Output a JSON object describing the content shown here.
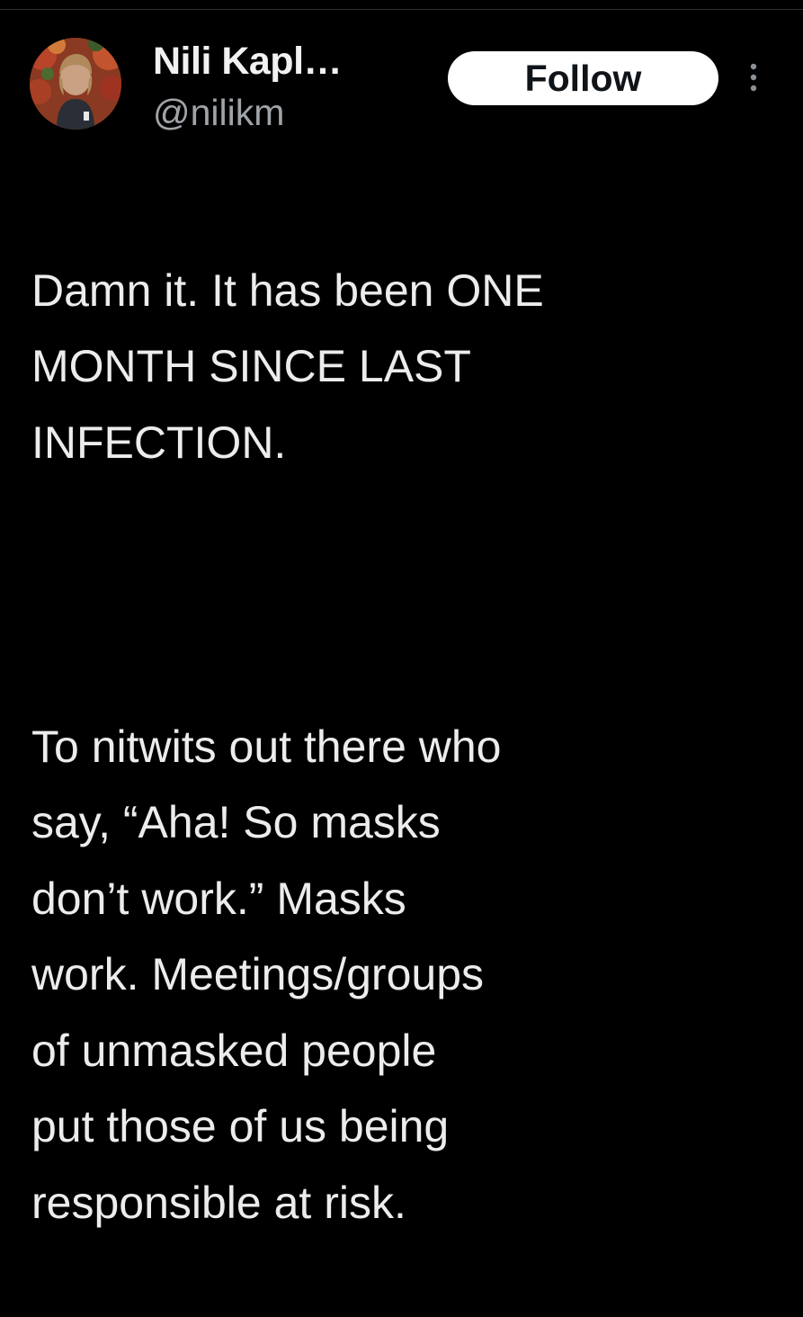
{
  "colors": {
    "background": "#000000",
    "text": "#ececec",
    "handle": "#a0a4a8",
    "follow_button_bg": "#ffffff",
    "follow_button_text": "#0f1419"
  },
  "author": {
    "display_name": "Nili Kapl…",
    "handle": "@nilikm",
    "avatar_icon": "profile-avatar"
  },
  "actions": {
    "follow_label": "Follow",
    "more_icon": "more-vertical-icon"
  },
  "tweet": {
    "paragraph_1": "Damn it. It has been ONE\nMONTH SINCE LAST\nINFECTION.",
    "paragraph_2": "To nitwits out there who\nsay, “Aha! So masks\ndon’t work.” Masks\nwork. Meetings/groups\nof unmasked people\nput those of us being\nresponsible at risk."
  }
}
